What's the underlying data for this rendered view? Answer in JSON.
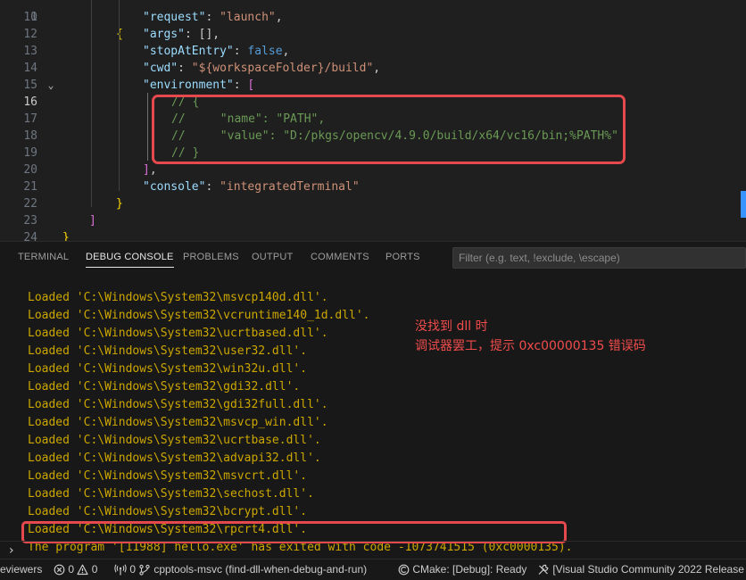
{
  "editor": {
    "lines": [
      {
        "n": "11",
        "segs": [
          {
            "t": "\"request\"",
            "c": "k"
          },
          {
            "t": ": ",
            "c": "p"
          },
          {
            "t": "\"launch\"",
            "c": "s"
          },
          {
            "t": ",",
            "c": "p"
          }
        ]
      },
      {
        "n": "12",
        "segs": [
          {
            "t": "\"args\"",
            "c": "k"
          },
          {
            "t": ": [],",
            "c": "p"
          }
        ]
      },
      {
        "n": "13",
        "segs": [
          {
            "t": "\"stopAtEntry\"",
            "c": "k"
          },
          {
            "t": ": ",
            "c": "p"
          },
          {
            "t": "false",
            "c": "b"
          },
          {
            "t": ",",
            "c": "p"
          }
        ]
      },
      {
        "n": "14",
        "segs": [
          {
            "t": "\"cwd\"",
            "c": "k"
          },
          {
            "t": ": ",
            "c": "p"
          },
          {
            "t": "\"${workspaceFolder}/build\"",
            "c": "s"
          },
          {
            "t": ",",
            "c": "p"
          }
        ]
      },
      {
        "n": "15",
        "fold": true,
        "segs": [
          {
            "t": "\"environment\"",
            "c": "k"
          },
          {
            "t": ": ",
            "c": "p"
          },
          {
            "t": "[",
            "c": "m"
          }
        ]
      },
      {
        "n": "16",
        "active": true,
        "segs": [
          {
            "t": "// {",
            "c": "c"
          }
        ]
      },
      {
        "n": "17",
        "segs": [
          {
            "t": "//     \"name\": \"PATH\",",
            "c": "c"
          }
        ]
      },
      {
        "n": "18",
        "segs": [
          {
            "t": "//     \"value\": \"D:/pkgs/opencv/4.9.0/build/x64/vc16/bin;%PATH%\"",
            "c": "c"
          }
        ]
      },
      {
        "n": "19",
        "segs": [
          {
            "t": "// }",
            "c": "c"
          }
        ]
      },
      {
        "n": "20",
        "segs": [
          {
            "t": "]",
            "c": "m"
          },
          {
            "t": ",",
            "c": "p"
          }
        ]
      },
      {
        "n": "21",
        "segs": [
          {
            "t": "\"console\"",
            "c": "k"
          },
          {
            "t": ": ",
            "c": "p"
          },
          {
            "t": "\"integratedTerminal\"",
            "c": "s"
          }
        ]
      },
      {
        "n": "22",
        "segs": [
          {
            "t": "}",
            "c": "y"
          }
        ]
      },
      {
        "n": "23",
        "segs": [
          {
            "t": "]",
            "c": "m"
          }
        ]
      },
      {
        "n": "24",
        "segs": [
          {
            "t": "}",
            "c": "y"
          }
        ]
      }
    ]
  },
  "panel": {
    "tabs": [
      {
        "label": "TERMINAL",
        "active": false
      },
      {
        "label": "DEBUG CONSOLE",
        "active": true
      },
      {
        "label": "PROBLEMS",
        "active": false
      },
      {
        "label": "OUTPUT",
        "active": false
      },
      {
        "label": "COMMENTS",
        "active": false
      },
      {
        "label": "PORTS",
        "active": false
      }
    ],
    "filter_placeholder": "Filter (e.g. text, !exclude, \\escape)",
    "output_lines": [
      "Loaded 'C:\\Windows\\System32\\msvcp140d.dll'.",
      "Loaded 'C:\\Windows\\System32\\vcruntime140_1d.dll'.",
      "Loaded 'C:\\Windows\\System32\\ucrtbased.dll'.",
      "Loaded 'C:\\Windows\\System32\\user32.dll'.",
      "Loaded 'C:\\Windows\\System32\\win32u.dll'.",
      "Loaded 'C:\\Windows\\System32\\gdi32.dll'.",
      "Loaded 'C:\\Windows\\System32\\gdi32full.dll'.",
      "Loaded 'C:\\Windows\\System32\\msvcp_win.dll'.",
      "Loaded 'C:\\Windows\\System32\\ucrtbase.dll'.",
      "Loaded 'C:\\Windows\\System32\\advapi32.dll'.",
      "Loaded 'C:\\Windows\\System32\\msvcrt.dll'.",
      "Loaded 'C:\\Windows\\System32\\sechost.dll'.",
      "Loaded 'C:\\Windows\\System32\\bcrypt.dll'.",
      "Loaded 'C:\\Windows\\System32\\rpcrt4.dll'.",
      "The program '[11988] hello.exe' has exited with code -1073741515 (0xc0000135)."
    ],
    "annotation": {
      "line1": "没找到 dll 时",
      "line2": "调试器罢工，提示 0xc00000135 错误码"
    },
    "prompt_symbol": "›"
  },
  "statusbar": {
    "reviewers": "eviewers",
    "errors": "0",
    "warnings": "0",
    "ports": "0",
    "project": "cpptools-msvc (find-dll-when-debug-and-run)",
    "cmake": "CMake: [Debug]: Ready",
    "kit": "[Visual Studio Community 2022 Release -"
  },
  "colors": {
    "editor_bg": "#1f1f1f",
    "panel_bg": "#181818",
    "output_text": "#cca700",
    "annotation": "#f14c4c",
    "highlight_box": "#e5484d"
  }
}
